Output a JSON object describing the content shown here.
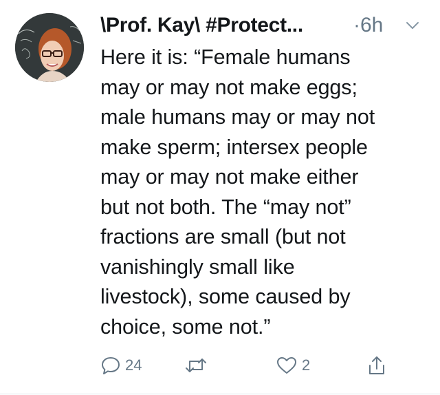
{
  "tweet": {
    "display_name": "\\Prof. Kay\\ #Protect...",
    "timestamp": "·6h",
    "text": "Here it is: “Female humans\nmay or may not make eggs;\nmale humans may or may not\nmake sperm; intersex people\nmay or may not make either\nbut not both. The “may not”\nfractions are small (but not\nvanishingly small like\nlivestock), some caused by\nchoice, some not.”",
    "actions": {
      "reply_count": "24",
      "retweet_count": "",
      "like_count": "2"
    },
    "icons": {
      "avatar": "profile-photo",
      "caret": "chevron-down-icon",
      "reply": "reply-icon",
      "retweet": "retweet-icon",
      "like": "heart-icon",
      "share": "share-icon"
    },
    "colors": {
      "text": "#14171a",
      "secondary": "#657786",
      "background": "#ffffff"
    }
  }
}
